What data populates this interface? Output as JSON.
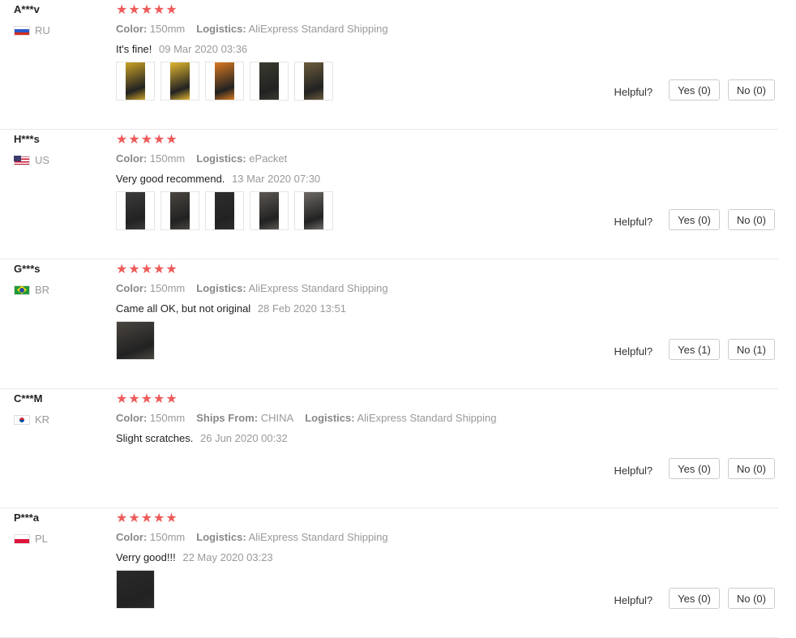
{
  "reviews": [
    {
      "user": "A***v",
      "country": "RU",
      "flag": "ru",
      "stars": "★★★★★",
      "meta": [
        {
          "k": "Color:",
          "v": "150mm"
        },
        {
          "k": "Logistics:",
          "v": "AliExpress Standard Shipping"
        }
      ],
      "text": "It's fine!",
      "date": "09 Mar 2020 03:36",
      "photos": [
        "#c9a227",
        "#e0b630",
        "#d97a20",
        "#3a3a2f",
        "#6b5b3c"
      ],
      "helpful": "Helpful?",
      "yes": "Yes (0)",
      "no": "No (0)"
    },
    {
      "user": "H***s",
      "country": "US",
      "flag": "us",
      "stars": "★★★★★",
      "meta": [
        {
          "k": "Color:",
          "v": "150mm"
        },
        {
          "k": "Logistics:",
          "v": "ePacket"
        }
      ],
      "text": "Very good recommend.",
      "date": "13 Mar 2020 07:30",
      "photos": [
        "#3b3b3b",
        "#4a4640",
        "#2e2e2e",
        "#5c5752",
        "#6e6a66"
      ],
      "helpful": "Helpful?",
      "yes": "Yes (0)",
      "no": "No (0)"
    },
    {
      "user": "G***s",
      "country": "BR",
      "flag": "br",
      "stars": "★★★★★",
      "meta": [
        {
          "k": "Color:",
          "v": "150mm"
        },
        {
          "k": "Logistics:",
          "v": "AliExpress Standard Shipping"
        }
      ],
      "text": "Came all OK, but not original",
      "date": "28 Feb 2020 13:51",
      "photos": [
        "#4a4540"
      ],
      "helpful": "Helpful?",
      "yes": "Yes (1)",
      "no": "No (1)"
    },
    {
      "user": "C***M",
      "country": "KR",
      "flag": "kr",
      "stars": "★★★★★",
      "meta": [
        {
          "k": "Color:",
          "v": "150mm"
        },
        {
          "k": "Ships From:",
          "v": "CHINA"
        },
        {
          "k": "Logistics:",
          "v": "AliExpress Standard Shipping"
        }
      ],
      "text": "Slight scratches.",
      "date": "26 Jun 2020 00:32",
      "photos": [],
      "helpful": "Helpful?",
      "yes": "Yes (0)",
      "no": "No (0)"
    },
    {
      "user": "P***a",
      "country": "PL",
      "flag": "pl",
      "stars": "★★★★★",
      "meta": [
        {
          "k": "Color:",
          "v": "150mm"
        },
        {
          "k": "Logistics:",
          "v": "AliExpress Standard Shipping"
        }
      ],
      "text": "Verry good!!!",
      "date": "22 May 2020 03:23",
      "photos": [
        "#2a2a2a"
      ],
      "helpful": "Helpful?",
      "yes": "Yes (0)",
      "no": "No (0)"
    }
  ]
}
